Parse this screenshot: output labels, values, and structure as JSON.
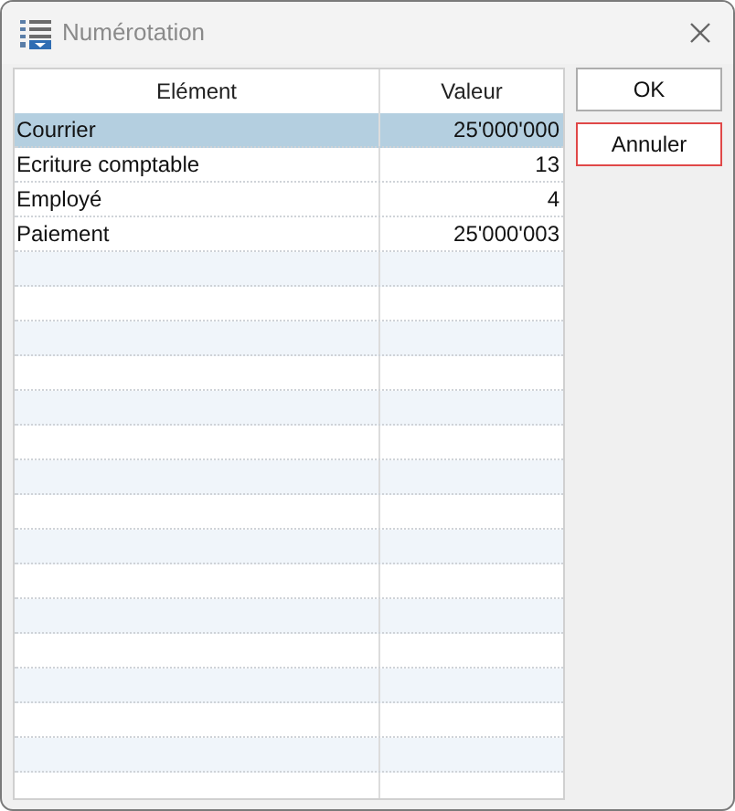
{
  "window": {
    "title": "Numérotation"
  },
  "table": {
    "columns": [
      "Elément",
      "Valeur"
    ],
    "rows": [
      {
        "element": "Courrier",
        "value": "25'000'000",
        "selected": true
      },
      {
        "element": "Ecriture comptable",
        "value": "13",
        "selected": false
      },
      {
        "element": "Employé",
        "value": "4",
        "selected": false
      },
      {
        "element": "Paiement",
        "value": "25'000'003",
        "selected": false
      }
    ]
  },
  "buttons": [
    {
      "label": "OK",
      "focused": false
    },
    {
      "label": "Annuler",
      "focused": true
    }
  ]
}
